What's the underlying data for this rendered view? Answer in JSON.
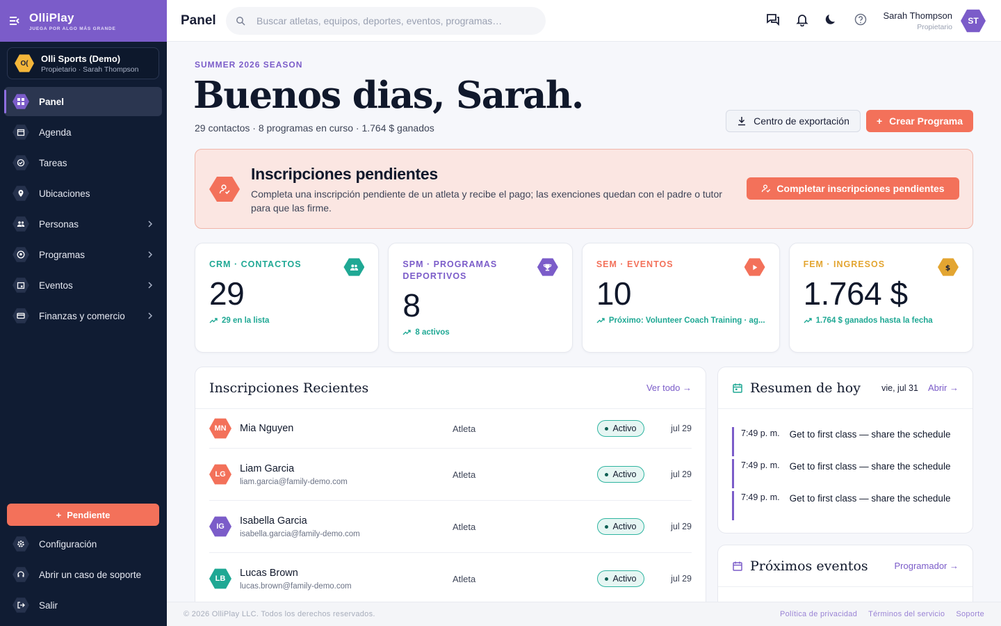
{
  "colors": {
    "brand": "#7b5cc9",
    "accent": "#f3715a",
    "sidebar": "#101c33",
    "teal": "#1fa894",
    "orange": "#f3715a",
    "gold": "#e3a531"
  },
  "brand": {
    "name": "OlliPlay",
    "tagline": "JUEGA POR ALGO MÁS GRANDE"
  },
  "org": {
    "logo": "O(",
    "name": "Olli Sports (Demo)",
    "sub": "Propietario · Sarah Thompson"
  },
  "nav": [
    {
      "label": "Panel",
      "icon": "dashboard-icon"
    },
    {
      "label": "Agenda",
      "icon": "calendar-icon"
    },
    {
      "label": "Tareas",
      "icon": "check-icon"
    },
    {
      "label": "Ubicaciones",
      "icon": "pin-icon"
    },
    {
      "label": "Personas",
      "icon": "people-icon"
    },
    {
      "label": "Programas",
      "icon": "ball-icon"
    },
    {
      "label": "Eventos",
      "icon": "event-icon"
    },
    {
      "label": "Finanzas y comercio",
      "icon": "card-icon"
    }
  ],
  "pending_button": "Pendiente",
  "bottom_nav": [
    {
      "label": "Configuración",
      "icon": "gear-icon"
    },
    {
      "label": "Abrir un caso de soporte",
      "icon": "support-icon"
    },
    {
      "label": "Salir",
      "icon": "logout-icon"
    }
  ],
  "header": {
    "title": "Panel",
    "search_placeholder": "Buscar atletas, equipos, deportes, eventos, programas…",
    "user_name": "Sarah Thompson",
    "user_role": "Propietario",
    "user_initials": "ST"
  },
  "hero": {
    "season": "SUMMER 2026 SEASON",
    "greeting": "Buenos dias, Sarah.",
    "summary": "29 contactos · 8 programas en curso · 1.764 $ ganados",
    "export_label": "Centro de exportación",
    "create_label": "Crear Programa"
  },
  "alert": {
    "title": "Inscripciones pendientes",
    "text": "Completa una inscripción pendiente de un atleta y recibe el pago; las exenciones quedan con el padre o tutor para que las firme.",
    "button": "Completar inscripciones pendientes"
  },
  "stats": [
    {
      "label": "CRM · CONTACTOS",
      "value": "29",
      "note": "29 en la lista",
      "color": "#1fa894",
      "icon": "group-icon"
    },
    {
      "label": "SPM · PROGRAMAS DEPORTIVOS",
      "value": "8",
      "note": "8 activos",
      "color": "#7b5cc9",
      "icon": "trophy-icon"
    },
    {
      "label": "SEM · EVENTOS",
      "value": "10",
      "note": "Próximo: Volunteer Coach Training · ag...",
      "color": "#f3715a",
      "icon": "play-icon"
    },
    {
      "label": "FEM · INGRESOS",
      "value": "1.764 $",
      "note": "1.764 $ ganados hasta la fecha",
      "color": "#e3a531",
      "icon": "dollar-icon"
    }
  ],
  "recent": {
    "title": "Inscripciones Recientes",
    "link": "Ver todo →",
    "rows": [
      {
        "initials": "MN",
        "name": "Mia Nguyen",
        "email": "",
        "role": "Atleta",
        "status": "Activo",
        "date": "jul 29",
        "color": "#f3715a"
      },
      {
        "initials": "LG",
        "name": "Liam Garcia",
        "email": "liam.garcia@family-demo.com",
        "role": "Atleta",
        "status": "Activo",
        "date": "jul 29",
        "color": "#f3715a"
      },
      {
        "initials": "IG",
        "name": "Isabella Garcia",
        "email": "isabella.garcia@family-demo.com",
        "role": "Atleta",
        "status": "Activo",
        "date": "jul 29",
        "color": "#7b5cc9"
      },
      {
        "initials": "LB",
        "name": "Lucas Brown",
        "email": "lucas.brown@family-demo.com",
        "role": "Atleta",
        "status": "Activo",
        "date": "jul 29",
        "color": "#1fa894"
      }
    ]
  },
  "today": {
    "title": "Resumen de hoy",
    "date": "vie, jul 31",
    "link": "Abrir →",
    "items": [
      {
        "time": "7:49 p. m.",
        "text": "Get to first class — share the schedule"
      },
      {
        "time": "7:49 p. m.",
        "text": "Get to first class — share the schedule"
      },
      {
        "time": "7:49 p. m.",
        "text": "Get to first class — share the schedule"
      }
    ]
  },
  "upcoming": {
    "title": "Próximos eventos",
    "link": "Programador →"
  },
  "footer": {
    "copyright": "© 2026 OlliPlay LLC. Todos los derechos reservados.",
    "links": [
      "Política de privacidad",
      "Términos del servicio",
      "Soporte"
    ]
  }
}
